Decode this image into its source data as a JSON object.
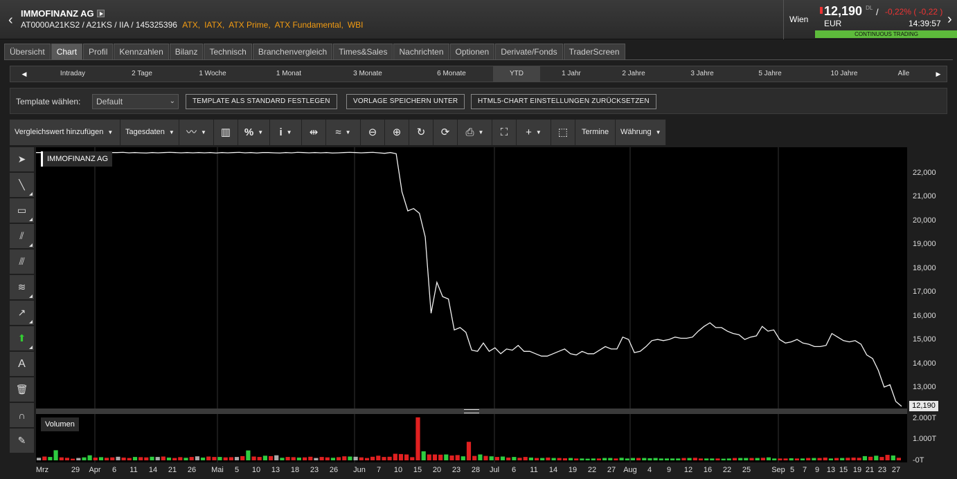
{
  "header": {
    "name": "IMMOFINANZ AG",
    "ids": "AT0000A21KS2 / A21KS / IIA / 145325396",
    "indices": [
      "ATX,",
      "IATX,",
      "ATX Prime,",
      "ATX Fundamental,",
      "WBI"
    ],
    "exchange": "Wien",
    "price": "12,190",
    "price_suffix": "DL",
    "change": "-0,22% ( -0,22 )",
    "currency": "EUR",
    "time": "14:39:57",
    "status": "CONTINUOUS TRADING"
  },
  "tabs": [
    "Übersicht",
    "Chart",
    "Profil",
    "Kennzahlen",
    "Bilanz",
    "Technisch",
    "Branchenvergleich",
    "Times&Sales",
    "Nachrichten",
    "Optionen",
    "Derivate/Fonds",
    "TraderScreen"
  ],
  "periods": [
    "Intraday",
    "2 Tage",
    "1 Woche",
    "1 Monat",
    "3 Monate",
    "6 Monate",
    "YTD",
    "1 Jahr",
    "2 Jahre",
    "3 Jahre",
    "5 Jahre",
    "10 Jahre",
    "Alle"
  ],
  "template": {
    "label": "Template wählen:",
    "selected": "Default",
    "btn_default": "TEMPLATE ALS STANDARD FESTLEGEN",
    "btn_save": "VORLAGE SPEICHERN UNTER",
    "btn_reset": "HTML5-CHART EINSTELLUNGEN ZURÜCKSETZEN"
  },
  "toolbar": {
    "compare": "Vergleichswert hinzufügen",
    "data": "Tagesdaten",
    "termine": "Termine",
    "waehrung": "Währung"
  },
  "chart": {
    "series_label": "IMMOFINANZ AG",
    "volume_label": "Volumen",
    "last_price": "12,190",
    "y_labels": [
      "22,000",
      "21,000",
      "20,000",
      "19,000",
      "18,000",
      "17,000",
      "16,000",
      "15,000",
      "14,000",
      "13,000"
    ],
    "vol_labels": [
      "2.000T",
      "1.000T",
      "-0T"
    ],
    "x_labels": [
      "Mrz",
      "29",
      "Apr",
      "6",
      "11",
      "14",
      "21",
      "26",
      "Mai",
      "5",
      "10",
      "13",
      "18",
      "23",
      "26",
      "Jun",
      "7",
      "10",
      "15",
      "20",
      "23",
      "28",
      "Jul",
      "6",
      "11",
      "14",
      "19",
      "22",
      "27",
      "Aug",
      "4",
      "9",
      "12",
      "16",
      "22",
      "25",
      "Sep",
      "5",
      "7",
      "9",
      "13",
      "15",
      "19",
      "21",
      "23",
      "27"
    ]
  },
  "chart_data": {
    "type": "line",
    "ylim": [
      12000,
      22800
    ],
    "values": [
      22850,
      22850,
      22830,
      22840,
      22850,
      22830,
      22840,
      22850,
      22860,
      22840,
      22850,
      22830,
      22840,
      22850,
      22850,
      22860,
      22840,
      22850,
      22840,
      22830,
      22850,
      22840,
      22850,
      22860,
      22850,
      22840,
      22850,
      22840,
      22850,
      22840,
      22850,
      22830,
      22850,
      22840,
      22850,
      22860,
      22840,
      22850,
      22830,
      22850,
      22850,
      22840,
      22830,
      22850,
      22840,
      22860,
      22850,
      22840,
      22850,
      22840,
      22850,
      22830,
      22840,
      22850,
      22860,
      22850,
      22840,
      22850,
      22860,
      22840,
      22820,
      22850,
      22800,
      21200,
      20400,
      20500,
      20300,
      19300,
      16100,
      17400,
      16800,
      16700,
      15400,
      15500,
      15300,
      14550,
      14500,
      14850,
      14500,
      14650,
      14400,
      14600,
      14550,
      14750,
      14500,
      14500,
      14400,
      14300,
      14300,
      14400,
      14500,
      14600,
      14400,
      14350,
      14500,
      14400,
      14400,
      14550,
      14700,
      14600,
      14600,
      15100,
      15000,
      14450,
      14500,
      14700,
      14950,
      15000,
      14950,
      15000,
      15100,
      15050,
      15050,
      15100,
      15350,
      15550,
      15700,
      15500,
      15500,
      15350,
      15250,
      15200,
      15000,
      15100,
      15150,
      15550,
      15350,
      15400,
      15000,
      14850,
      14900,
      15000,
      14850,
      14800,
      14700,
      14700,
      14750,
      15250,
      15100,
      14950,
      14900,
      14950,
      14800,
      14350,
      14200,
      13700,
      13000,
      13100,
      12400,
      12190
    ],
    "volume": {
      "max": 2000,
      "values": [
        120,
        180,
        160,
        480,
        140,
        120,
        80,
        110,
        140,
        240,
        130,
        150,
        120,
        140,
        170,
        130,
        110,
        160,
        150,
        140,
        170,
        160,
        180,
        130,
        110,
        150,
        120,
        160,
        190,
        130,
        180,
        160,
        160,
        140,
        150,
        160,
        200,
        470,
        180,
        160,
        220,
        200,
        240,
        120,
        160,
        150,
        130,
        140,
        170,
        110,
        160,
        140,
        120,
        150,
        190,
        180,
        170,
        140,
        110,
        170,
        220,
        160,
        170,
        310,
        300,
        280,
        150,
        2040,
        430,
        280,
        280,
        270,
        280,
        230,
        250,
        190,
        880,
        210,
        280,
        210,
        190,
        160,
        180,
        130,
        160,
        120,
        160,
        130,
        110,
        110,
        130,
        110,
        110,
        100,
        110,
        90,
        90,
        80,
        90,
        90,
        110,
        110,
        90,
        120,
        90,
        110,
        110,
        110,
        100,
        110,
        90,
        90,
        90,
        90,
        110,
        110,
        120,
        90,
        90,
        90,
        90,
        80,
        90,
        110,
        110,
        110,
        110,
        110,
        120,
        140,
        90,
        90,
        90,
        100,
        90,
        90,
        110,
        110,
        110,
        130,
        90,
        110,
        110,
        120,
        130,
        120,
        200,
        170,
        220,
        160,
        260,
        230,
        120
      ],
      "up": [
        1,
        0,
        1,
        1,
        0,
        0,
        0,
        0,
        1,
        1,
        0,
        1,
        0,
        0,
        1,
        0,
        0,
        1,
        0,
        0,
        1,
        0,
        0,
        1,
        0,
        0,
        1,
        0,
        0,
        1,
        0,
        0,
        1,
        0,
        0,
        1,
        0,
        1,
        0,
        0,
        1,
        0,
        0,
        1,
        0,
        0,
        1,
        0,
        0,
        1,
        0,
        0,
        1,
        0,
        0,
        1,
        0,
        0,
        0,
        0,
        0,
        0,
        0,
        0,
        0,
        0,
        0,
        0,
        1,
        0,
        0,
        0,
        1,
        0,
        0,
        1,
        0,
        0,
        1,
        0,
        1,
        0,
        1,
        0,
        1,
        0,
        0,
        1,
        0,
        1,
        0,
        1,
        0,
        0,
        1,
        0,
        1,
        1,
        1,
        0,
        1,
        1,
        0,
        1,
        1,
        1,
        0,
        1,
        1,
        1,
        1,
        1,
        1,
        1,
        0,
        1,
        0,
        0,
        1,
        1,
        0,
        1,
        1,
        0,
        1,
        1,
        0,
        1,
        0,
        1,
        1,
        0,
        0,
        1,
        0,
        1,
        0,
        1,
        0,
        0,
        1,
        0,
        1,
        0,
        0,
        0,
        1,
        0,
        1,
        0,
        0,
        1,
        0
      ]
    }
  }
}
